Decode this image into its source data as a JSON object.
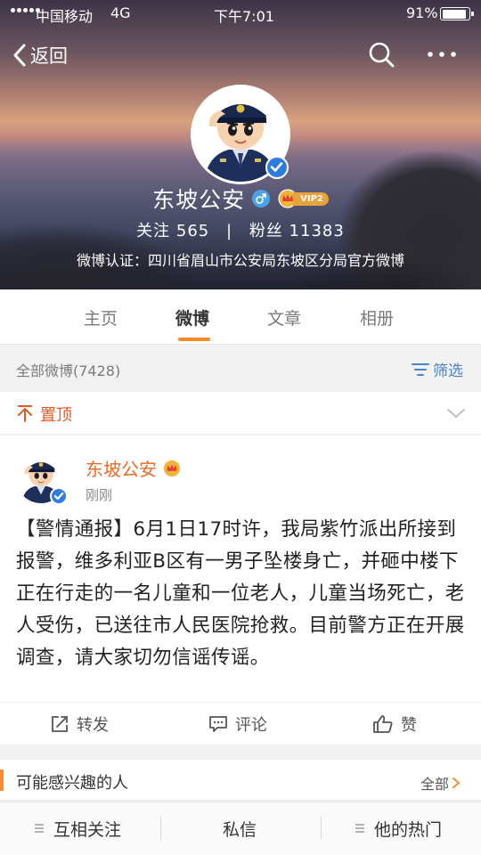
{
  "status_bar": {
    "carrier": "中国移动",
    "network": "4G",
    "time": "下午7:01",
    "battery_percent": "91%",
    "battery_level": 0.91
  },
  "nav": {
    "back_label": "返回",
    "search_icon": "search-icon",
    "more_icon": "more-icon"
  },
  "profile": {
    "name": "东坡公安",
    "vip_label": "VIP2",
    "following_label": "关注",
    "following_count": "565",
    "separator": "|",
    "followers_label": "粉丝",
    "followers_count": "11383",
    "verification": "微博认证：四川省眉山市公安局东坡区分局官方微博"
  },
  "tabs": [
    {
      "label": "主页",
      "active": false
    },
    {
      "label": "微博",
      "active": true
    },
    {
      "label": "文章",
      "active": false
    },
    {
      "label": "相册",
      "active": false
    }
  ],
  "filter": {
    "all_label": "全部微博(7428)",
    "filter_label": "筛选"
  },
  "pinned": {
    "label": "置顶"
  },
  "post": {
    "author": "东坡公安",
    "time": "刚刚",
    "text": "【警情通报】6月1日17时许，我局紫竹派出所接到报警，维多利亚B区有一男子坠楼身亡，并砸中楼下正在行走的一名儿童和一位老人，儿童当场死亡，老人受伤，已送往市人民医院抢救。目前警方正在开展调查，请大家切勿信谣传谣。",
    "actions": {
      "repost": "转发",
      "comment": "评论",
      "like": "赞"
    }
  },
  "suggest": {
    "title": "可能感兴趣的人",
    "all_label": "全部"
  },
  "bottom_bar": {
    "follow_each_other": "互相关注",
    "message": "私信",
    "his_hot": "他的热门"
  },
  "colors": {
    "accent_orange": "#fe8a29",
    "author_orange": "#e86b28",
    "link_blue": "#4a84c4",
    "verify_blue": "#2d7de0",
    "vip_gold": "#e9a33b"
  }
}
